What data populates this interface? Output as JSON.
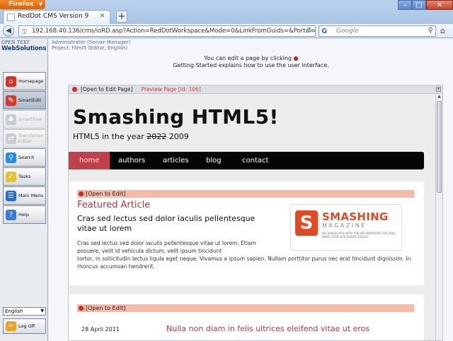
{
  "browser": {
    "app_button": "Firefox",
    "tab_title": "RedDot CMS Version 9",
    "url": "192.168.40.136/cms/ioRD.asp?Action=RedDotWorkspace&Mode=0&LinkFromGuids=&Portal=&ActiveTr",
    "search_placeholder": "Google"
  },
  "cms": {
    "brand_top": "OPEN TEXT",
    "brand_name": "WebSolutions",
    "admin_line1": "Administrator (Server Manager)",
    "admin_line2": "Project: html5 (Editor, English)",
    "hint_line1": "You can edit a page by clicking",
    "hint_line2": "Getting Started explains how to use the user interface.",
    "sidebar": [
      {
        "label": "Homepage",
        "icon": "home-icon",
        "color": "#c53a2e",
        "state": "normal"
      },
      {
        "label": "SmartEdit",
        "icon": "smartedit-icon",
        "color": "#d23b2b",
        "state": "active"
      },
      {
        "label": "SmartTree",
        "icon": "smarttree-icon",
        "color": "#c9ccd2",
        "state": "disabled"
      },
      {
        "label": "Translation Editor",
        "icon": "translation-icon",
        "color": "#c9ccd2",
        "state": "disabled"
      },
      {
        "label": "Search",
        "icon": "search-icon",
        "color": "#2d8ad6",
        "state": "normal"
      },
      {
        "label": "Tasks",
        "icon": "tasks-icon",
        "color": "#e7c232",
        "state": "normal"
      },
      {
        "label": "Main Menu",
        "icon": "main-menu-icon",
        "color": "#2b6cc4",
        "state": "normal"
      },
      {
        "label": "Help",
        "icon": "help-icon",
        "color": "#3a7ad6",
        "state": "normal"
      }
    ],
    "language": "English",
    "logoff": "Log Off"
  },
  "page": {
    "open_label": "[Open to Edit Page]",
    "preview_label": "Preview Page [Id: 106]",
    "site_title": "Smashing HTML5!",
    "site_sub_prefix": "HTML5 in the year",
    "site_sub_struck": "2022",
    "site_sub_year": "2009",
    "nav": [
      "home",
      "authors",
      "articles",
      "blog",
      "contact"
    ],
    "edit_label": "[Open to Edit]",
    "featured_title": "Featured Article",
    "featured_headline": "Cras sed lectus sed dolor iaculis pellentesque vitae ut lorem",
    "featured_body_1": "Cras sed lectus sed dolor iaculis pellentesque vitae ut lorem. Etiam posuere, velit id vehicula dictum, velit ipsum tincidunt",
    "featured_body_2": "tortor, in sollicitudin lectus ligula eget neque. Vivamus a ipsum sapien. Nullam porttitor purus nec erat tincidunt dignissim. In rhoncus accumsan hendrerit.",
    "logo_name": "SMASHING",
    "logo_mag": "MAGAZINE",
    "logo_tag": "WE SMASH YOU WITH THE INFORMATION THAT WILL MAKE YOUR LIFE EASIER. REALLY.",
    "edit_label_2": "[Open to Edit]",
    "post_date": "28 April 2011",
    "post_title": "Nulla non diam in felis ultrices eleifend vitae ut eros"
  }
}
